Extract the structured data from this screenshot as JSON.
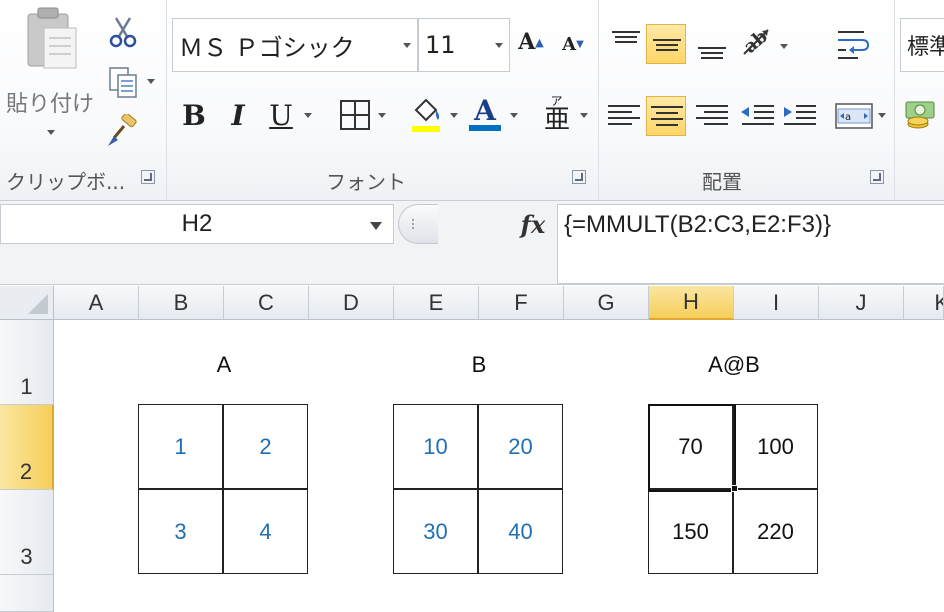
{
  "ribbon": {
    "clipboard": {
      "paste_label": "貼り付け",
      "group_label": "クリップボ..."
    },
    "font": {
      "name": "ＭＳ Ｐゴシック",
      "size": "11",
      "bold": "B",
      "italic": "I",
      "underline": "U",
      "font_color_letter": "A",
      "grow": "A",
      "shrink": "A",
      "phonetic": "亜",
      "group_label": "フォント"
    },
    "alignment": {
      "group_label": "配置"
    },
    "number": {
      "format": "標準"
    }
  },
  "formula_bar": {
    "name_box": "H2",
    "fx": "fx",
    "formula": "{=MMULT(B2:C3,E2:F3)}"
  },
  "sheet": {
    "columns": [
      "A",
      "B",
      "C",
      "D",
      "E",
      "F",
      "G",
      "H",
      "I",
      "J",
      "K"
    ],
    "selected_column": "H",
    "rows": [
      "1",
      "2",
      "3"
    ],
    "selected_row": "2",
    "titles": {
      "a": "A",
      "b": "B",
      "ab": "A@B"
    },
    "matrix_a": [
      [
        "1",
        "2"
      ],
      [
        "3",
        "4"
      ]
    ],
    "matrix_b": [
      [
        "10",
        "20"
      ],
      [
        "30",
        "40"
      ]
    ],
    "matrix_ab": [
      [
        "70",
        "100"
      ],
      [
        "150",
        "220"
      ]
    ]
  },
  "colors": {
    "selected_header": "#f5cf5a",
    "input_value": "#1f6fb2",
    "font_color_bar": "#0070c0"
  }
}
